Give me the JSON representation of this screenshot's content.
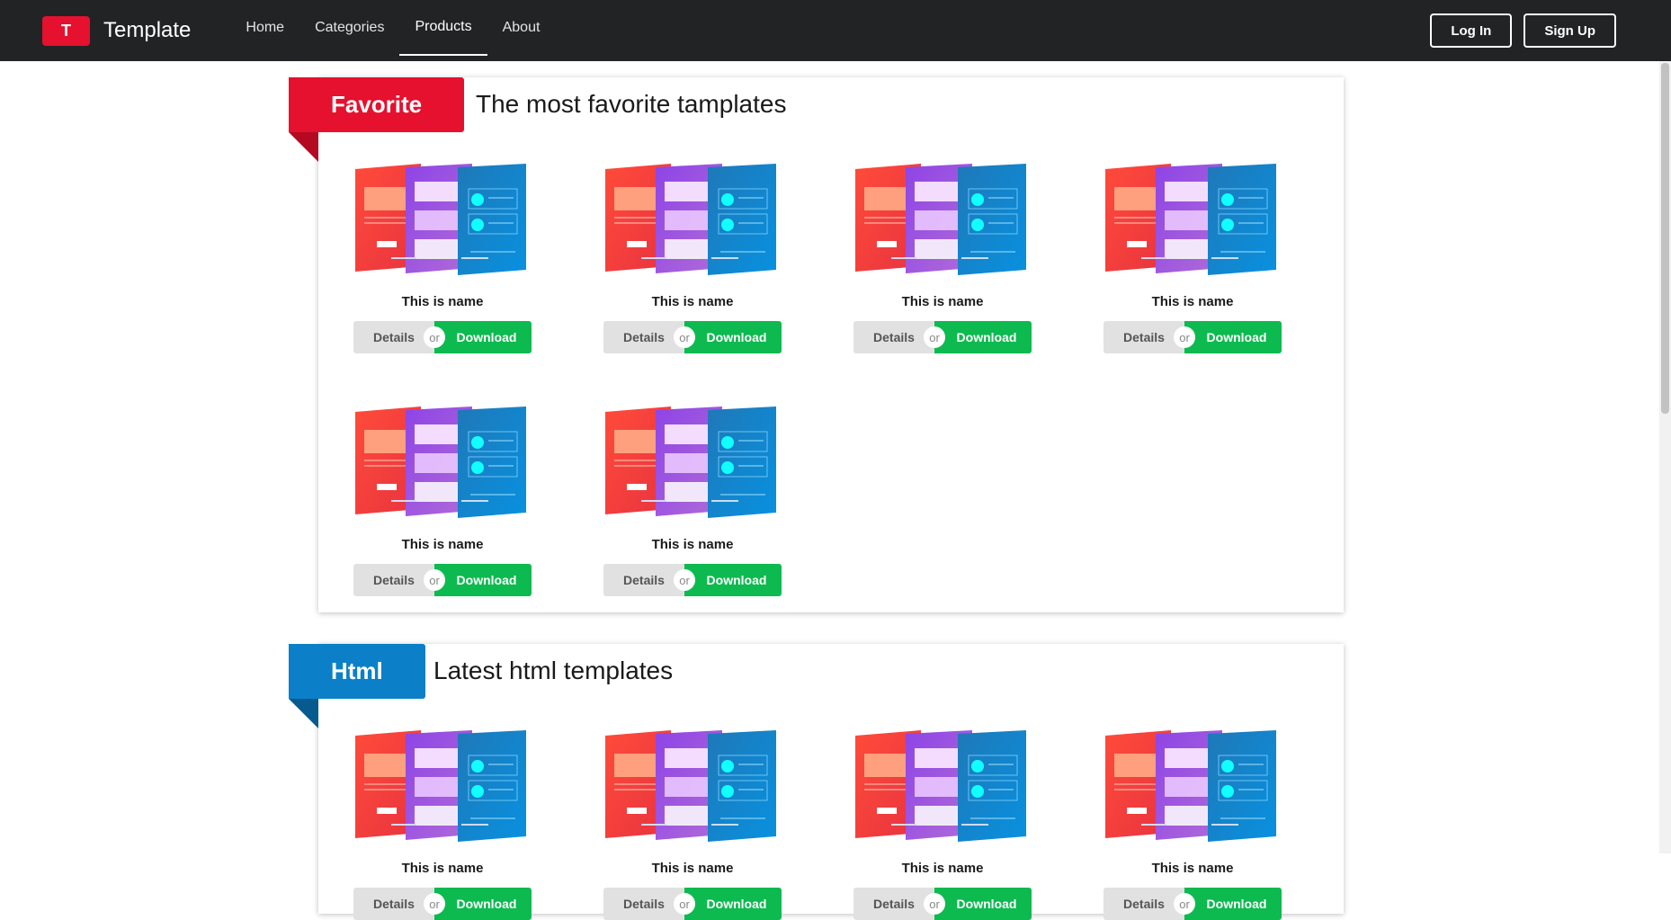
{
  "navbar": {
    "logo_letter": "T",
    "brand": "Template",
    "links": [
      {
        "label": "Home",
        "active": false
      },
      {
        "label": "Categories",
        "active": false
      },
      {
        "label": "Products",
        "active": true
      },
      {
        "label": "About",
        "active": false
      }
    ],
    "login": "Log In",
    "signup": "Sign Up"
  },
  "colors": {
    "navbar": "#222324",
    "brand_red": "#e6102f",
    "download_green": "#0dba4f",
    "details_gray": "#e1e1e2",
    "html_blue": "#0b80c8"
  },
  "sections": [
    {
      "ribbon": "Favorite",
      "ribbon_color": "#e6102f",
      "ribbon_fold_color": "#b30a22",
      "title": "The most favorite tamplates",
      "cards": [
        {
          "name": "This is name",
          "details": "Details",
          "or": "or",
          "download": "Download"
        },
        {
          "name": "This is name",
          "details": "Details",
          "or": "or",
          "download": "Download"
        },
        {
          "name": "This is name",
          "details": "Details",
          "or": "or",
          "download": "Download"
        },
        {
          "name": "This is name",
          "details": "Details",
          "or": "or",
          "download": "Download"
        },
        {
          "name": "This is name",
          "details": "Details",
          "or": "or",
          "download": "Download"
        },
        {
          "name": "This is name",
          "details": "Details",
          "or": "or",
          "download": "Download"
        }
      ]
    },
    {
      "ribbon": "Html",
      "ribbon_color": "#0b80c8",
      "ribbon_fold_color": "#075a8e",
      "title": "Latest html templates",
      "cards": [
        {
          "name": "This is name",
          "details": "Details",
          "or": "or",
          "download": "Download"
        },
        {
          "name": "This is name",
          "details": "Details",
          "or": "or",
          "download": "Download"
        },
        {
          "name": "This is name",
          "details": "Details",
          "or": "or",
          "download": "Download"
        },
        {
          "name": "This is name",
          "details": "Details",
          "or": "or",
          "download": "Download"
        }
      ]
    }
  ]
}
